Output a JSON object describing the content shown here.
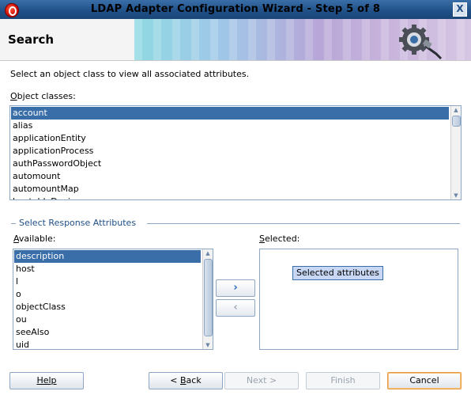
{
  "window": {
    "title": "LDAP Adapter Configuration Wizard - Step 5 of 8",
    "close_glyph": "X"
  },
  "header": {
    "heading": "Search"
  },
  "instruction": "Select an object class to view all associated attributes.",
  "object_classes": {
    "label_mnemonic": "O",
    "label_rest": "bject classes:",
    "items": [
      "account",
      "alias",
      "applicationEntity",
      "applicationProcess",
      "authPasswordObject",
      "automount",
      "automountMap",
      "bootableDevice"
    ],
    "selected": "account"
  },
  "response_attributes": {
    "group_title": "Select Response Attributes",
    "available_label_mnemonic": "A",
    "available_label_rest": "vailable:",
    "selected_label_mnemonic": "S",
    "selected_label_rest": "elected:",
    "available_items": [
      "description",
      "host",
      "l",
      "o",
      "objectClass",
      "ou",
      "seeAlso",
      "uid"
    ],
    "available_selected": "description",
    "selected_placeholder": "Selected attributes",
    "add_glyph": "›",
    "remove_glyph": "‹"
  },
  "buttons": {
    "help": "Help",
    "back_prefix": "< ",
    "back_mnemonic": "B",
    "back_rest": "ack",
    "next": "Next >",
    "finish": "Finish",
    "cancel": "Cancel"
  },
  "colors": {
    "title_bar": "#1f4f86",
    "selection": "#3a6ea8",
    "default_button_border": "#e89a3c"
  },
  "icons": [
    "app-logo-icon",
    "close-icon",
    "wizard-gear-icon",
    "scroll-up-arrow-icon",
    "scroll-down-arrow-icon",
    "move-right-icon",
    "move-left-icon"
  ]
}
